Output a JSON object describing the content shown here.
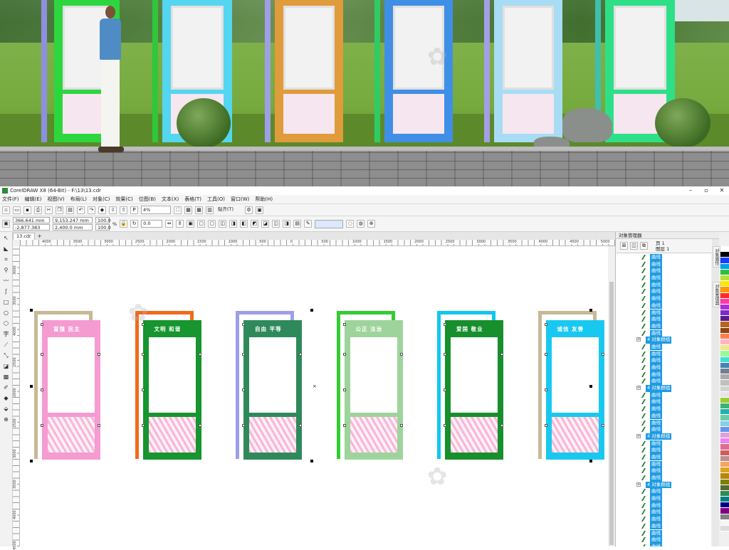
{
  "app": {
    "title": "CorelDRAW X8 (64-Bit) - F:\\13\\13.cdr",
    "window_buttons": [
      "–",
      "▫",
      "✕"
    ],
    "menu": [
      "文件(F)",
      "编辑(E)",
      "视图(V)",
      "布局(L)",
      "对象(C)",
      "效果(C)",
      "位图(B)",
      "文本(X)",
      "表格(T)",
      "工具(O)",
      "窗口(W)",
      "帮助(H)"
    ],
    "zoom": "4%",
    "snap_label": "贴齐(T)",
    "x_value": "366.641 mm",
    "y_value": "-2,877.383 mm",
    "width_value": "9,153.247 mm",
    "height_value": "2,400.0 mm",
    "scale_x": "100.0",
    "scale_y": "100.0",
    "pct": "%",
    "rotation": "0.0",
    "doc_tab": "13.cdr",
    "new_tab": "+"
  },
  "ruler": {
    "h_labels": [
      "4000",
      "3500",
      "3000",
      "2500",
      "2000",
      "1500",
      "1000",
      "500",
      "0",
      "500",
      "1000",
      "1500",
      "2000",
      "2500",
      "3000",
      "3500",
      "4000",
      "4500",
      "5000"
    ],
    "v_labels": [
      "3000",
      "3500",
      "4000",
      "2500",
      "2000",
      "2500",
      "3000",
      "3500",
      "4000",
      "4500"
    ]
  },
  "boards": [
    {
      "title": "富强  民主",
      "frame_color": "#c8b896",
      "front_color": "#f59bd1"
    },
    {
      "title": "文明  和谐",
      "frame_color": "#f26a1b",
      "front_color": "#17952e"
    },
    {
      "title": "自由  平等",
      "frame_color": "#9c9ee8",
      "front_color": "#2f8a5b"
    },
    {
      "title": "公正  法治",
      "frame_color": "#33cc33",
      "front_color": "#9ed49c"
    },
    {
      "title": "爱国  敬业",
      "frame_color": "#11c6f0",
      "front_color": "#178f2c"
    },
    {
      "title": "诚信  友善",
      "frame_color": "#c8b896",
      "front_color": "#19c8f0"
    }
  ],
  "object_manager": {
    "title": "对象管理器",
    "page": "页 1",
    "layer": "图层 1",
    "item_label": "曲线",
    "group_label": "4 对象群组",
    "rows": [
      "c",
      "c",
      "c",
      "c",
      "c",
      "c",
      "c",
      "c",
      "c",
      "c",
      "c",
      "c",
      "g",
      "c",
      "c",
      "c",
      "c",
      "c",
      "c",
      "g",
      "c",
      "c",
      "c",
      "c",
      "c",
      "c",
      "g",
      "c",
      "c",
      "c",
      "c",
      "c",
      "c",
      "g",
      "c",
      "c",
      "c",
      "c",
      "c",
      "c",
      "c",
      "c",
      "c",
      "c",
      "c",
      "c"
    ]
  },
  "dock_tabs": [
    "对象属性",
    "对象管理器"
  ],
  "palette": [
    "#ffffff",
    "#000000",
    "#1a3cff",
    "#00a0e9",
    "#2fbf3f",
    "#b8e03a",
    "#ffe600",
    "#ff9a00",
    "#ff2a2a",
    "#ff3aa8",
    "#b02cd6",
    "#7a2cc8",
    "#5a1a8a",
    "#b5651d",
    "#8b4513",
    "#ff7f50",
    "#ffb6c1",
    "#f0e68c",
    "#98fb98",
    "#40e0d0",
    "#4682b4",
    "#708090",
    "#a9a9a9",
    "#c0c0c0",
    "#d3d3d3",
    "#e6e6e6",
    "#9acd32",
    "#3cb371",
    "#20b2aa",
    "#66cdaa",
    "#87ceeb",
    "#6495ed",
    "#dda0dd",
    "#ee82ee",
    "#db7093",
    "#cd5c5c",
    "#bc8f8f",
    "#f4a460",
    "#daa520",
    "#b8860b",
    "#808000",
    "#556b2f",
    "#2e8b57",
    "#008080",
    "#000080",
    "#800080",
    "#808080",
    "#f5f5f5",
    "#dcdcdc"
  ]
}
